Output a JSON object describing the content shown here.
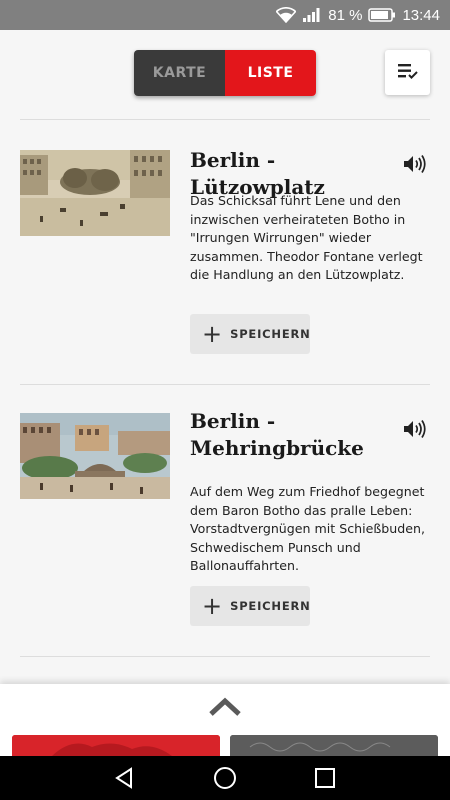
{
  "status_bar": {
    "battery_percent": "81 %",
    "time": "13:44",
    "icons": [
      "wifi-icon",
      "signal-icon",
      "battery-icon"
    ]
  },
  "header": {
    "toggle": {
      "karte_label": "KARTE",
      "liste_label": "LISTE",
      "selected": "LISTE"
    },
    "sort_icon": "sort-list-icon"
  },
  "colors": {
    "accent": "#e3161b",
    "toggle_inactive": "#3a3a3a"
  },
  "items": [
    {
      "title": "Berlin - Lützowplatz",
      "description": "Das Schicksal führt Lene und den inzwischen verheirateten Botho in \"Irrungen Wirrungen\" wieder zusammen. Theodor Fontane verlegt die Handlung an den Lützowplatz.",
      "save_label": "SPEICHERN",
      "audio_icon": "speaker-icon"
    },
    {
      "title": "Berlin - Mehringbrücke",
      "description": "Auf dem Weg zum Friedhof begegnet dem Baron Botho das pralle Leben: Vorstadtvergnügen mit Schießbuden, Schwedischem Punsch und Ballonauffahrten.",
      "save_label": "SPEICHERN",
      "audio_icon": "speaker-icon"
    }
  ],
  "bottom_panel": {
    "expand_icon": "chevron-up-icon"
  },
  "nav_bar": {
    "icons": [
      "back-icon",
      "home-icon",
      "recents-icon"
    ]
  }
}
